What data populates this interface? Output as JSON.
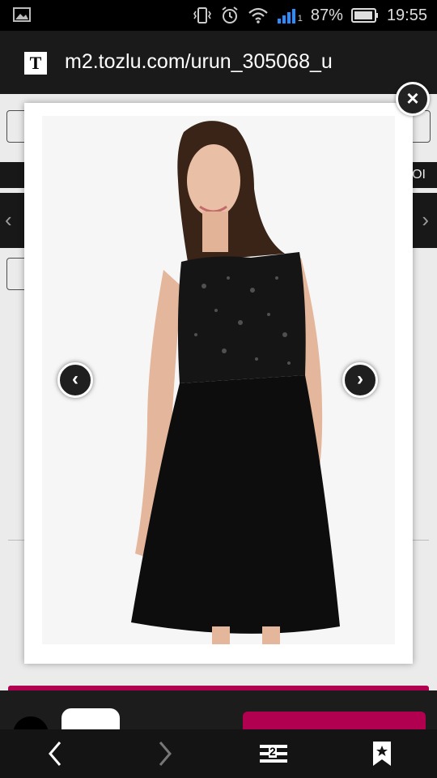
{
  "status_bar": {
    "battery_percent": "87%",
    "time": "19:55",
    "signal_sub": "1"
  },
  "browser": {
    "url": "m2.tozlu.com/urun_305068_u",
    "site_icon_letter": "T",
    "tab_count": "2"
  },
  "background_page": {
    "bar_text": "OI"
  },
  "modal": {
    "close_symbol": "×",
    "prev_symbol": "‹",
    "next_symbol": "›"
  },
  "colors": {
    "accent": "#b0004f",
    "dark": "#1a1a1a"
  }
}
